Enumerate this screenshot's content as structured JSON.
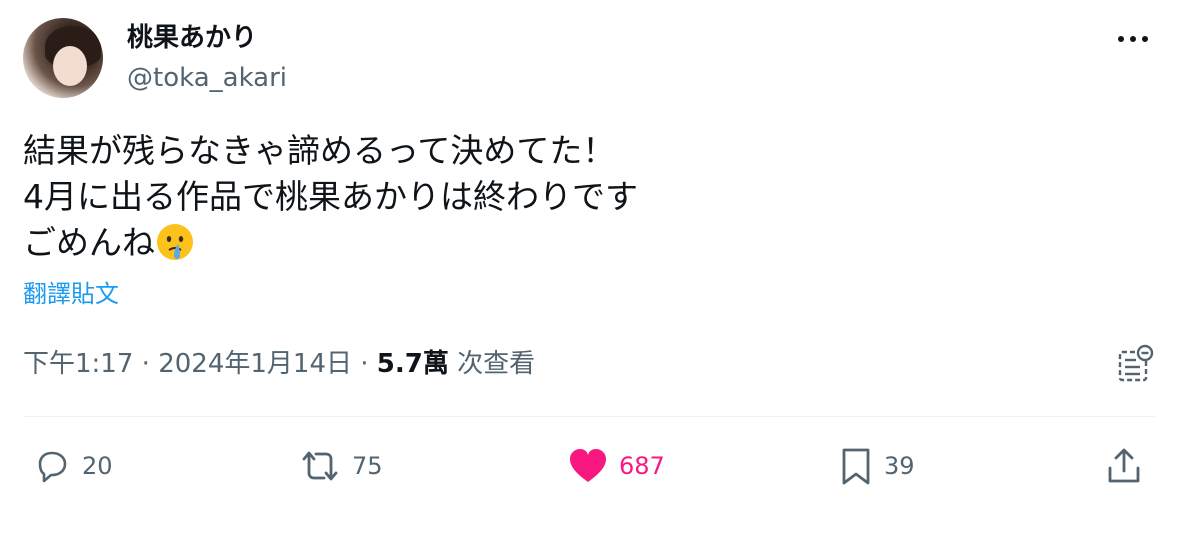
{
  "author": {
    "display_name": "桃果あかり",
    "handle": "@toka_akari"
  },
  "tweet": {
    "lines": [
      "結果が残らなきゃ諦めるって決めてた！",
      "4月に出る作品で桃果あかりは終わりです",
      "ごめんね"
    ],
    "emoji": "face-holding-back-tears",
    "translate_label": "翻譯貼文"
  },
  "meta": {
    "time": "下午1:17",
    "separator": " · ",
    "date": "2024年1月14日",
    "views_count": "5.7萬",
    "views_label": " 次查看"
  },
  "actions": {
    "reply_count": "20",
    "retweet_count": "75",
    "like_count": "687",
    "bookmark_count": "39"
  },
  "colors": {
    "text": "#0f1419",
    "secondary": "#536471",
    "link": "#1d9bf0",
    "like": "#f91880",
    "divider": "#eff3f4"
  }
}
